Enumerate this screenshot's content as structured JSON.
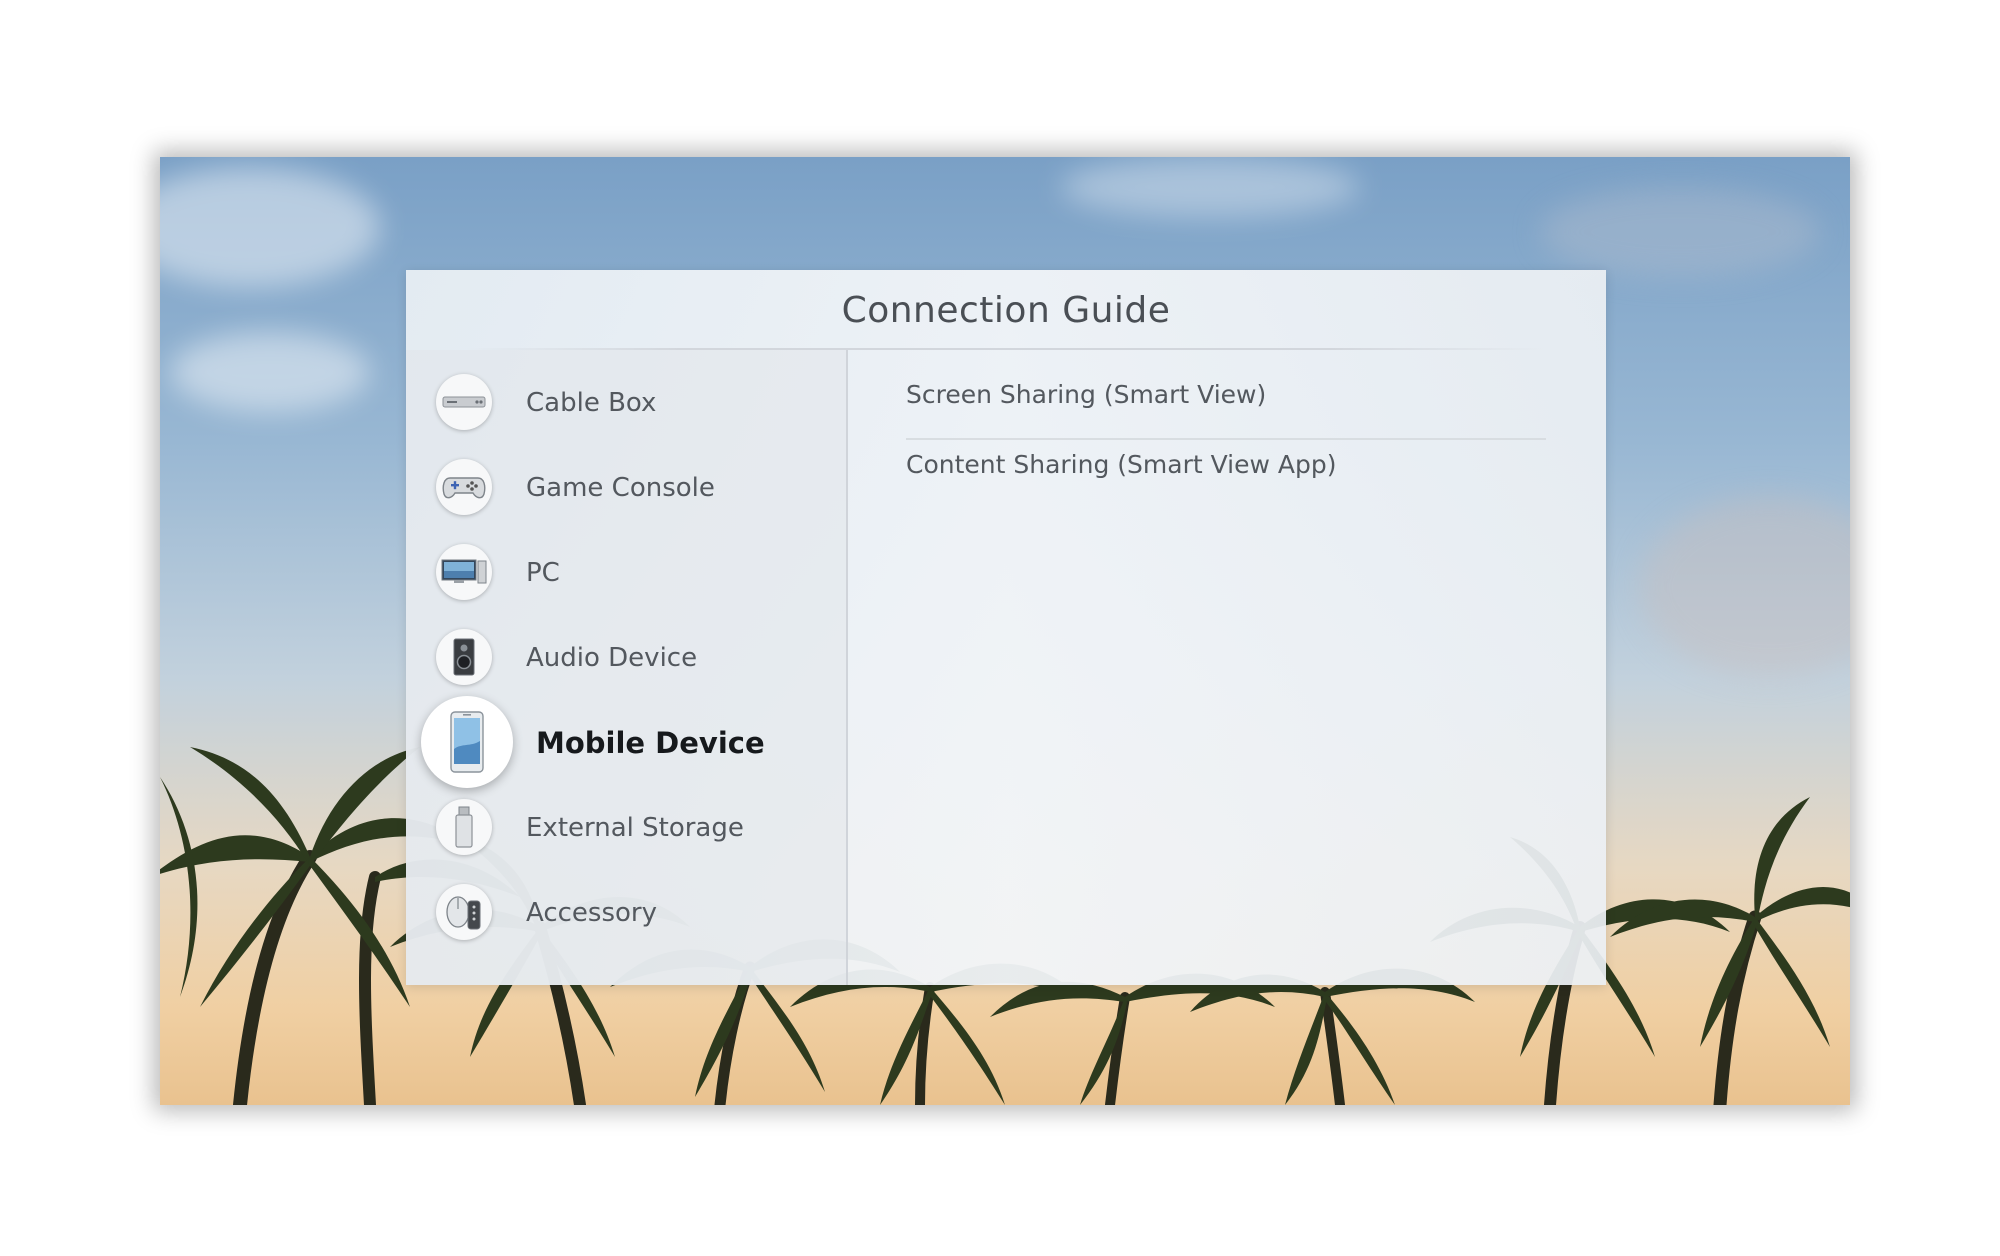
{
  "dialog": {
    "title": "Connection Guide"
  },
  "categories": [
    {
      "label": "Cable Box",
      "icon": "cable-box-icon",
      "selected": false
    },
    {
      "label": "Game Console",
      "icon": "game-controller-icon",
      "selected": false
    },
    {
      "label": "PC",
      "icon": "pc-monitor-icon",
      "selected": false
    },
    {
      "label": "Audio Device",
      "icon": "speaker-icon",
      "selected": false
    },
    {
      "label": "Mobile Device",
      "icon": "smartphone-icon",
      "selected": true
    },
    {
      "label": "External Storage",
      "icon": "usb-drive-icon",
      "selected": false
    },
    {
      "label": "Accessory",
      "icon": "mouse-remote-icon",
      "selected": false
    }
  ],
  "options": [
    {
      "label": "Screen Sharing (Smart View)"
    },
    {
      "label": "Content Sharing (Smart View App)"
    }
  ],
  "background": {
    "scene": "palm-trees-sky"
  }
}
